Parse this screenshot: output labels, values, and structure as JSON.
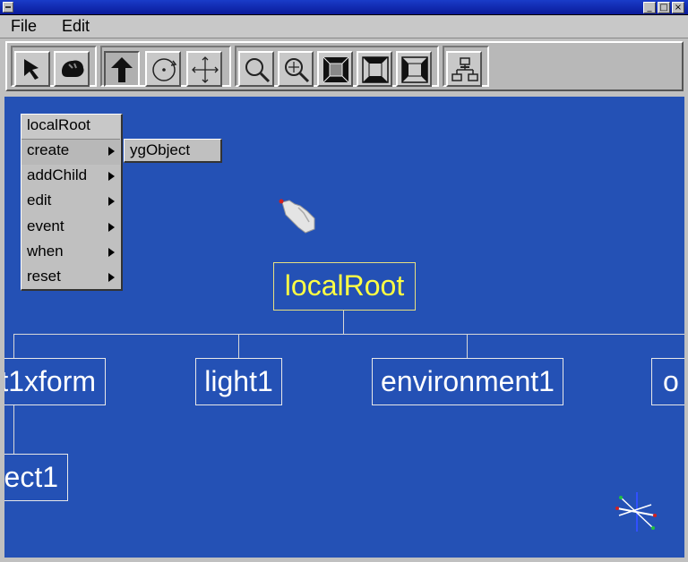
{
  "menubar": {
    "file": "File",
    "edit": "Edit"
  },
  "window_buttons": {
    "minimize": "_",
    "maximize": "□",
    "close": "×"
  },
  "toolbar": {
    "tools": [
      {
        "name": "select-arrow-icon"
      },
      {
        "name": "navigate-hand-icon"
      },
      {
        "name": "move-up-icon",
        "pressed": true
      },
      {
        "name": "rotate-icon"
      },
      {
        "name": "translate-cross-icon"
      },
      {
        "name": "zoom-icon"
      },
      {
        "name": "zoom-fit-icon"
      },
      {
        "name": "view-front-icon"
      },
      {
        "name": "view-top-icon"
      },
      {
        "name": "view-side-icon"
      },
      {
        "name": "scene-graph-icon"
      }
    ]
  },
  "context_menu": {
    "header": "localRoot",
    "items": [
      "create",
      "addChild",
      "edit",
      "event",
      "when",
      "reset"
    ],
    "submenu": "ygObject"
  },
  "scene_graph": {
    "root": "localRoot",
    "children": [
      "t1xform",
      "light1",
      "environment1",
      "o"
    ],
    "grandchild": "ject1"
  },
  "colors": {
    "canvas": "#2451b5",
    "root_text": "#ffff44",
    "node_text": "#ffffff",
    "titlebar": "#1a3cc8"
  }
}
